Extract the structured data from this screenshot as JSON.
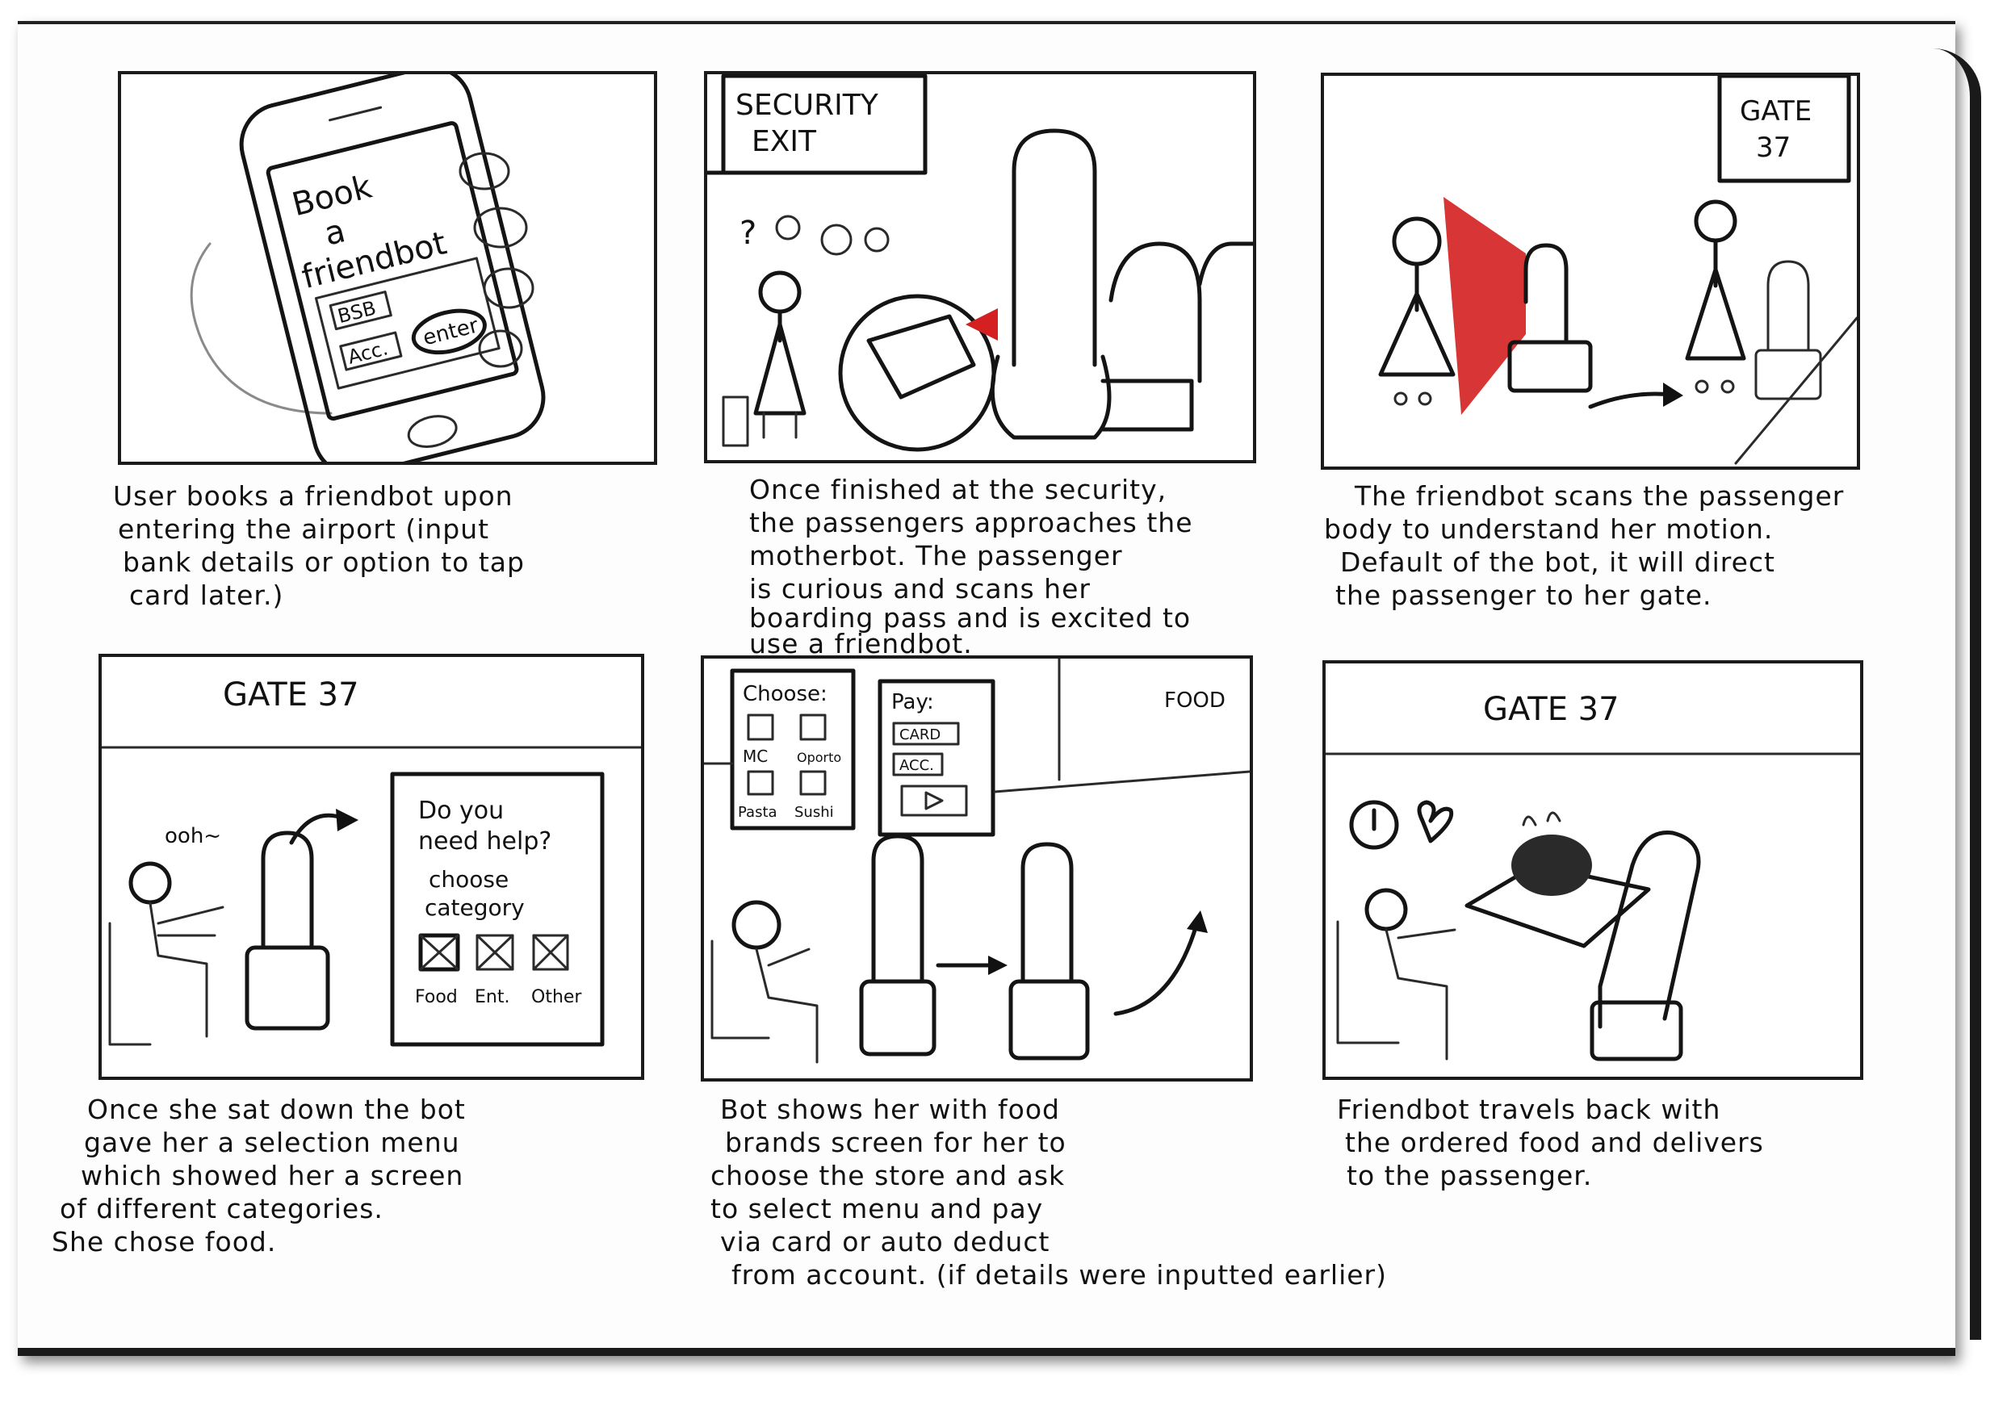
{
  "panels": [
    {
      "id": "p1",
      "screen_title_lines": [
        "Book",
        "a",
        "friendbot"
      ],
      "field_bsb": "BSB",
      "field_acc": "Acc.",
      "enter_button": "enter",
      "caption_lines": [
        "User books a friendbot upon",
        "entering the airport (input",
        "bank details or option to tap",
        "card later.)"
      ]
    },
    {
      "id": "p2",
      "sign_lines": [
        "SECURITY",
        "EXIT"
      ],
      "caption_lines": [
        "Once finished at the security,",
        "the passengers approaches the",
        "motherbot. The passenger",
        "is curious and scans her",
        "boarding pass and is excited to",
        "use a friendbot."
      ]
    },
    {
      "id": "p3",
      "sign_lines": [
        "GATE",
        "37"
      ],
      "caption_lines": [
        "The friendbot scans the passenger",
        "body to understand her motion.",
        "Default of the bot, it will direct",
        "the passenger to her gate."
      ]
    },
    {
      "id": "p4",
      "gate_label": "GATE 37",
      "speech": "ooh~",
      "screen_lines": [
        "Do you",
        "need help?",
        "choose",
        "category"
      ],
      "categories": [
        "Food",
        "Ent.",
        "Other"
      ],
      "caption_lines": [
        "Once she sat down the bot",
        "gave her a selection menu",
        "which showed her a screen",
        "of different categories.",
        "She chose food."
      ]
    },
    {
      "id": "p5",
      "choose_label": "Choose:",
      "choose_items": [
        "MC",
        "Oporto",
        "Pasta",
        "Sushi"
      ],
      "pay_label": "Pay:",
      "pay_options": [
        "CARD",
        "ACC."
      ],
      "food_sign": "FOOD",
      "caption_lines": [
        "Bot shows her with food",
        "brands screen for her to",
        "choose the store and ask",
        "to select menu and pay",
        "via card or auto deduct",
        "from account. (if details were inputted earlier)"
      ]
    },
    {
      "id": "p6",
      "gate_label": "GATE 37",
      "caption_lines": [
        "Friendbot travels back with",
        "the ordered food and delivers",
        "to the passenger."
      ]
    }
  ],
  "accent_color": "#d42020"
}
